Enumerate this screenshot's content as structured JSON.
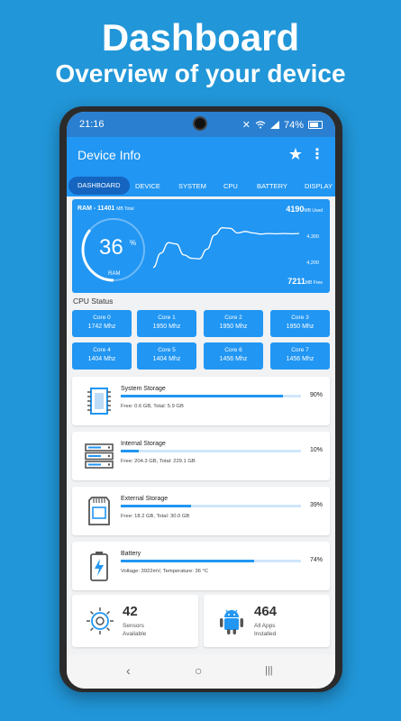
{
  "hero": {
    "title": "Dashboard",
    "subtitle": "Overview of your device"
  },
  "status_bar": {
    "time": "21:16",
    "battery": "74%"
  },
  "app_bar": {
    "title": "Device Info",
    "star_icon": "★",
    "more_icon": "⋮"
  },
  "tabs": [
    "DASHBOARD",
    "DEVICE",
    "SYSTEM",
    "CPU",
    "BATTERY",
    "DISPLAY"
  ],
  "ram": {
    "title": "RAM - 11401",
    "title_unit": "MB Total",
    "used": "4190",
    "used_unit": "MB Used",
    "free": "7211",
    "free_unit": "MB Free",
    "percent": "36",
    "percent_sign": "%",
    "label": "RAM",
    "tick_high": "4,300",
    "tick_low": "4,200",
    "usage_history": [
      4180,
      4235,
      4275,
      4270,
      4228,
      4215,
      4213,
      4250,
      4305,
      4332,
      4330,
      4312,
      4318,
      4312,
      4308,
      4310,
      4309,
      4310,
      4309,
      4310
    ]
  },
  "cpu": {
    "heading": "CPU Status",
    "cores": [
      {
        "name": "Core 0",
        "freq": "1742 Mhz"
      },
      {
        "name": "Core 1",
        "freq": "1950 Mhz"
      },
      {
        "name": "Core 2",
        "freq": "1950 Mhz"
      },
      {
        "name": "Core 3",
        "freq": "1950 Mhz"
      },
      {
        "name": "Core 4",
        "freq": "1404 Mhz"
      },
      {
        "name": "Core 5",
        "freq": "1404 Mhz"
      },
      {
        "name": "Core 6",
        "freq": "1456 Mhz"
      },
      {
        "name": "Core 7",
        "freq": "1456 Mhz"
      }
    ]
  },
  "storage": [
    {
      "title": "System Storage",
      "percent": "90%",
      "fill": 0.9,
      "detail": "Free: 0.6 GB,  Total: 5.9 GB",
      "icon": "chip-icon"
    },
    {
      "title": "Internal Storage",
      "percent": "10%",
      "fill": 0.1,
      "detail": "Free: 204.3 GB,  Total: 229.1 GB",
      "icon": "server-icon"
    },
    {
      "title": "External Storage",
      "percent": "39%",
      "fill": 0.39,
      "detail": "Free: 18.2 GB,  Total: 30.0 GB",
      "icon": "sd-card-icon"
    },
    {
      "title": "Battery",
      "percent": "74%",
      "fill": 0.74,
      "detail": "Voltage: 3922mV,  Temperature: 36 °C",
      "icon": "battery-icon"
    }
  ],
  "sensors": {
    "count": "42",
    "label1": "Sensors",
    "label2": "Available"
  },
  "apps": {
    "count": "464",
    "label1": "All Apps",
    "label2": "Installed"
  },
  "nav": {
    "back": "‹",
    "home": "○",
    "recents": "|||"
  },
  "colors": {
    "primary": "#2196f3",
    "background": "#2196d8",
    "dark_tab": "#1565c0",
    "bar_track": "#cfe6fb"
  }
}
